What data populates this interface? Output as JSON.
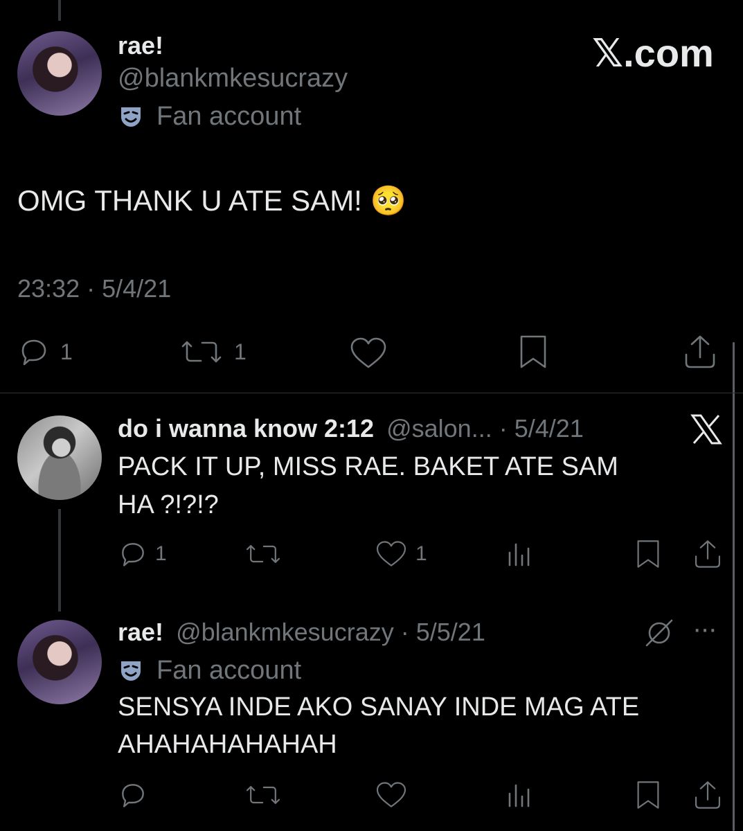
{
  "main_tweet": {
    "display_name": "rae!",
    "handle": "@blankmkesucrazy",
    "label": "Fan account",
    "text": "OMG THANK U ATE SAM! 🥺",
    "time": "23:32",
    "separator": "·",
    "date": "5/4/21",
    "actions": {
      "reply_count": "1",
      "retweet_count": "1"
    }
  },
  "watermark": {
    "text": "𝕏.com"
  },
  "replies": [
    {
      "display_name": "do i wanna know 2:12",
      "handle": "@salon...",
      "separator": "·",
      "date": "5/4/21",
      "text_line1": "PACK IT UP, MISS RAE. BAKET ATE SAM",
      "text_line2": "HA ?!?!?",
      "actions": {
        "reply_count": "1",
        "like_count": "1"
      }
    },
    {
      "display_name": "rae!",
      "handle": "@blankmkesucrazy",
      "separator": "·",
      "date": "5/5/21",
      "label": "Fan account",
      "text_line1": "SENSYA INDE AKO SANAY INDE MAG ATE",
      "text_line2": "AHAHAHAHAHAH",
      "more": "···"
    }
  ],
  "icons": {
    "reply": "reply-icon",
    "retweet": "retweet-icon",
    "like": "heart-icon",
    "bookmark": "bookmark-icon",
    "share": "share-icon",
    "views": "views-icon",
    "grok": "grok-icon",
    "x_logo": "x-logo-icon",
    "fan": "theater-mask-icon"
  }
}
